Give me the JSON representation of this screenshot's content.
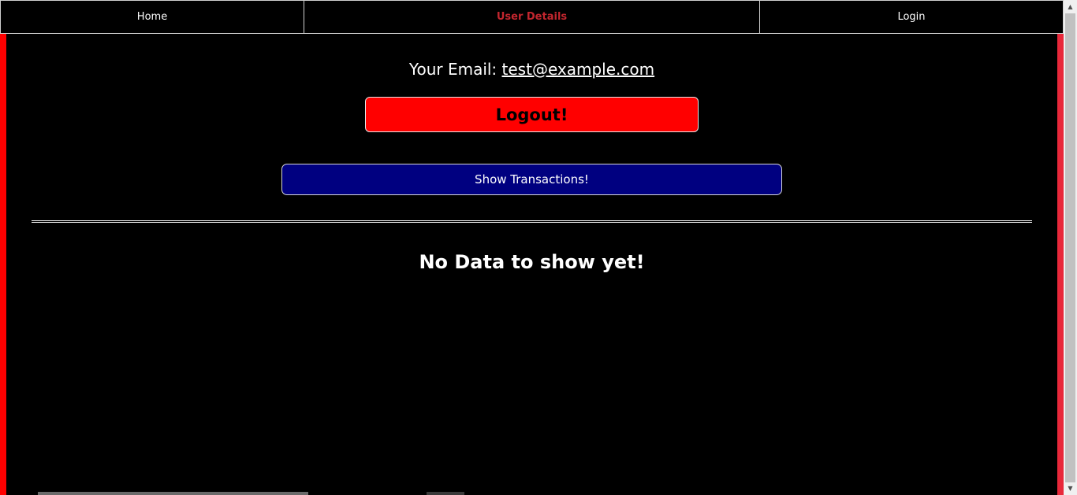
{
  "nav": {
    "home": "Home",
    "user_details": "User Details",
    "login": "Login"
  },
  "user": {
    "email_label": "Your Email:",
    "email": "test@example.com"
  },
  "buttons": {
    "logout": "Logout!",
    "show_transactions": "Show Transactions!"
  },
  "status": {
    "no_data": "No Data to show yet!"
  },
  "colors": {
    "background": "#000000",
    "active_nav": "#c2262e",
    "logout_bg": "#ff0000",
    "transactions_bg": "#000080",
    "side_border": "#ff0000"
  },
  "icons": {
    "scroll_up": "▲",
    "scroll_down": "▼"
  }
}
